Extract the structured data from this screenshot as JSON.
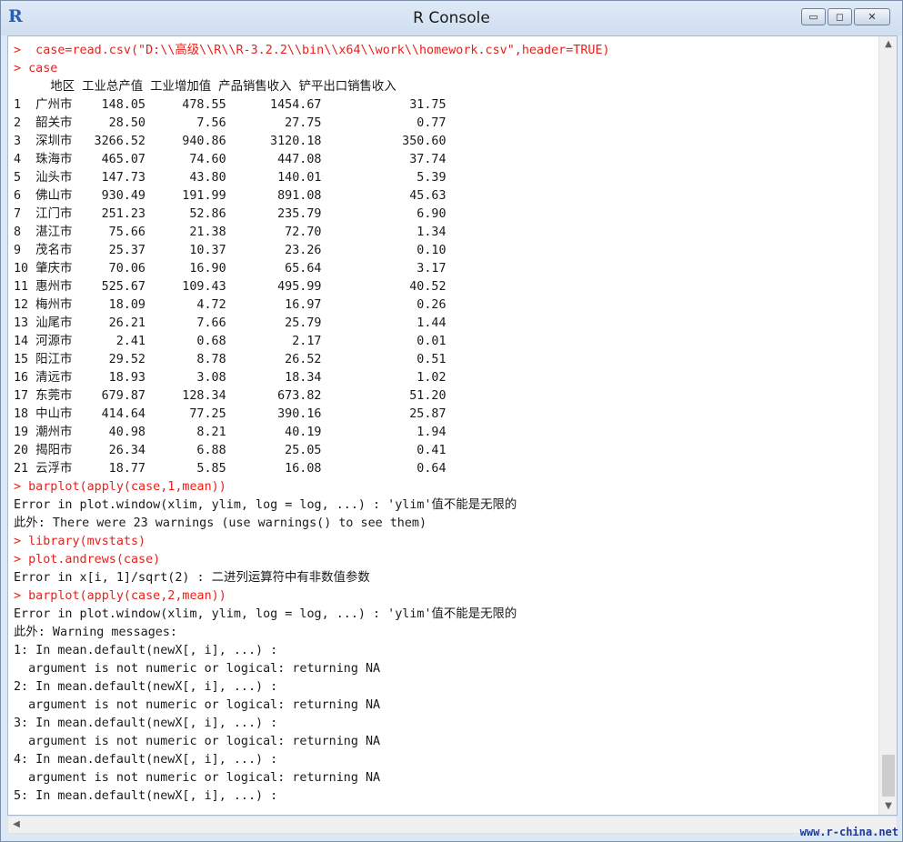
{
  "window": {
    "title": "R Console",
    "app_icon": "R",
    "controls": {
      "minimize": "▭",
      "maximize": "◻",
      "close": "✕"
    }
  },
  "console": {
    "lines": [
      {
        "type": "input",
        "text": ">  case=read.csv(\"D:\\\\高级\\\\R\\\\R-3.2.2\\\\bin\\\\x64\\\\work\\\\homework.csv\",header=TRUE)"
      },
      {
        "type": "input",
        "text": "> case"
      },
      {
        "type": "output",
        "text": "     地区 工业总产值 工业增加值 产品销售收入 铲平出口销售收入"
      },
      {
        "type": "output",
        "text": "1  广州市    148.05     478.55      1454.67            31.75"
      },
      {
        "type": "output",
        "text": "2  韶关市     28.50       7.56        27.75             0.77"
      },
      {
        "type": "output",
        "text": "3  深圳市   3266.52     940.86      3120.18           350.60"
      },
      {
        "type": "output",
        "text": "4  珠海市    465.07      74.60       447.08            37.74"
      },
      {
        "type": "output",
        "text": "5  汕头市    147.73      43.80       140.01             5.39"
      },
      {
        "type": "output",
        "text": "6  佛山市    930.49     191.99       891.08            45.63"
      },
      {
        "type": "output",
        "text": "7  江门市    251.23      52.86       235.79             6.90"
      },
      {
        "type": "output",
        "text": "8  湛江市     75.66      21.38        72.70             1.34"
      },
      {
        "type": "output",
        "text": "9  茂名市     25.37      10.37        23.26             0.10"
      },
      {
        "type": "output",
        "text": "10 肇庆市     70.06      16.90        65.64             3.17"
      },
      {
        "type": "output",
        "text": "11 惠州市    525.67     109.43       495.99            40.52"
      },
      {
        "type": "output",
        "text": "12 梅州市     18.09       4.72        16.97             0.26"
      },
      {
        "type": "output",
        "text": "13 汕尾市     26.21       7.66        25.79             1.44"
      },
      {
        "type": "output",
        "text": "14 河源市      2.41       0.68         2.17             0.01"
      },
      {
        "type": "output",
        "text": "15 阳江市     29.52       8.78        26.52             0.51"
      },
      {
        "type": "output",
        "text": "16 清远市     18.93       3.08        18.34             1.02"
      },
      {
        "type": "output",
        "text": "17 东莞市    679.87     128.34       673.82            51.20"
      },
      {
        "type": "output",
        "text": "18 中山市    414.64      77.25       390.16            25.87"
      },
      {
        "type": "output",
        "text": "19 潮州市     40.98       8.21        40.19             1.94"
      },
      {
        "type": "output",
        "text": "20 揭阳市     26.34       6.88        25.05             0.41"
      },
      {
        "type": "output",
        "text": "21 云浮市     18.77       5.85        16.08             0.64"
      },
      {
        "type": "input",
        "text": "> barplot(apply(case,1,mean))"
      },
      {
        "type": "error",
        "text": "Error in plot.window(xlim, ylim, log = log, ...) : 'ylim'值不能是无限的"
      },
      {
        "type": "error",
        "text": "此外: There were 23 warnings (use warnings() to see them)"
      },
      {
        "type": "input",
        "text": "> library(mvstats)"
      },
      {
        "type": "input",
        "text": "> plot.andrews(case)"
      },
      {
        "type": "error",
        "text": "Error in x[i, 1]/sqrt(2) : 二进列运算符中有非数值参数"
      },
      {
        "type": "input",
        "text": "> barplot(apply(case,2,mean))"
      },
      {
        "type": "error",
        "text": "Error in plot.window(xlim, ylim, log = log, ...) : 'ylim'值不能是无限的"
      },
      {
        "type": "error",
        "text": "此外: Warning messages:"
      },
      {
        "type": "error",
        "text": "1: In mean.default(newX[, i], ...) :"
      },
      {
        "type": "error",
        "text": "  argument is not numeric or logical: returning NA"
      },
      {
        "type": "error",
        "text": "2: In mean.default(newX[, i], ...) :"
      },
      {
        "type": "error",
        "text": "  argument is not numeric or logical: returning NA"
      },
      {
        "type": "error",
        "text": "3: In mean.default(newX[, i], ...) :"
      },
      {
        "type": "error",
        "text": "  argument is not numeric or logical: returning NA"
      },
      {
        "type": "error",
        "text": "4: In mean.default(newX[, i], ...) :"
      },
      {
        "type": "error",
        "text": "  argument is not numeric or logical: returning NA"
      },
      {
        "type": "error",
        "text": "5: In mean.default(newX[, i], ...) :"
      }
    ]
  },
  "scrollbars": {
    "up_arrow": "▲",
    "down_arrow": "▼",
    "left_arrow": "◀"
  },
  "watermark": "www.r-china.net",
  "colors": {
    "input": "#e8201b",
    "output": "#1a1a1a",
    "titlebar": "#dbe8f6"
  }
}
